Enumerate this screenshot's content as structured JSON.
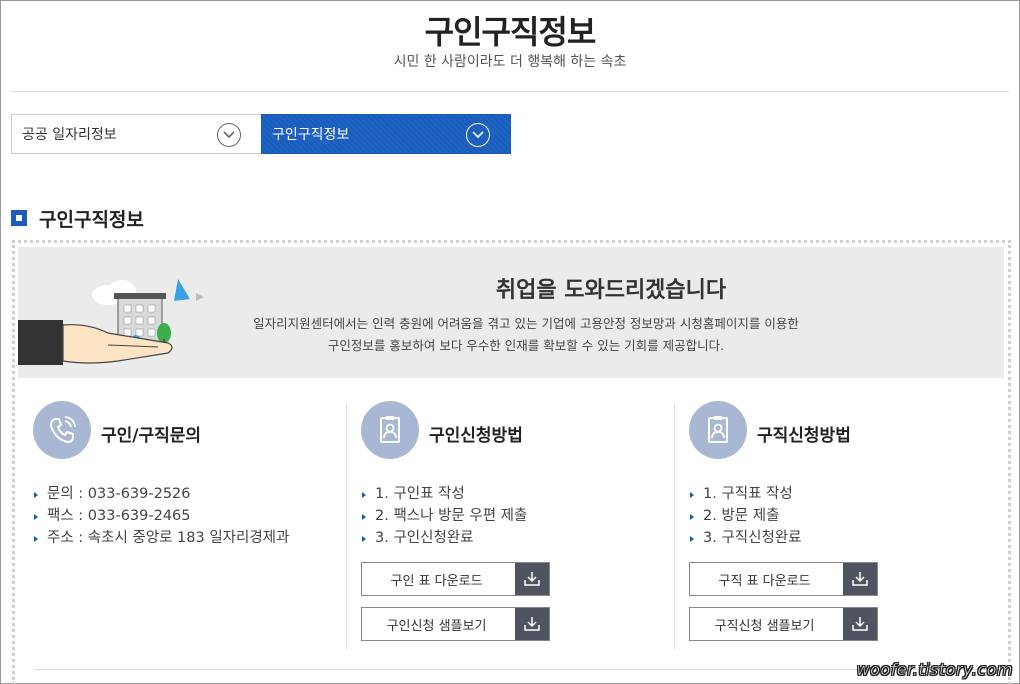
{
  "header": {
    "title": "구인구직정보",
    "subtitle": "시민 한 사람이라도 더 행복해 하는 속초"
  },
  "nav": {
    "dropdown1_label": "공공 일자리정보",
    "dropdown2_label": "구인구직정보"
  },
  "section": {
    "title": "구인구직정보"
  },
  "banner": {
    "title": "취업을 도와드리겠습니다",
    "line1": "일자리지원센터에서는 인력 충원에 어려움을 겪고 있는 기업에 고용안정 정보망과 시청홈페이지를 이용한",
    "line2": "구인정보를 홍보하여 보다 우수한 인재를 확보할 수 있는 기회를 제공합니다."
  },
  "columns": [
    {
      "title": "구인/구직문의",
      "icon": "phone-icon",
      "items": [
        "문의 : 033-639-2526",
        "팩스 : 033-639-2465",
        "주소 : 속초시 중앙로 183 일자리경제과"
      ]
    },
    {
      "title": "구인신청방법",
      "icon": "id-card-icon",
      "items": [
        "1. 구인표 작성",
        "2. 팩스나 방문 우편 제출",
        "3. 구인신청완료"
      ],
      "buttons": [
        "구인 표 다운로드",
        "구인신청 샘플보기"
      ]
    },
    {
      "title": "구직신청방법",
      "icon": "id-card-icon",
      "items": [
        "1. 구직표 작성",
        "2. 방문 제출",
        "3. 구직신청완료"
      ],
      "buttons": [
        "구직 표 다운로드",
        "구직신청 샘플보기"
      ]
    }
  ],
  "watermark": "woofer.tistory.com",
  "colors": {
    "accent": "#1a5dbb",
    "icon_circle": "#a8b7d3",
    "button_dark": "#4f5460",
    "banner_bg": "#ebebeb"
  }
}
